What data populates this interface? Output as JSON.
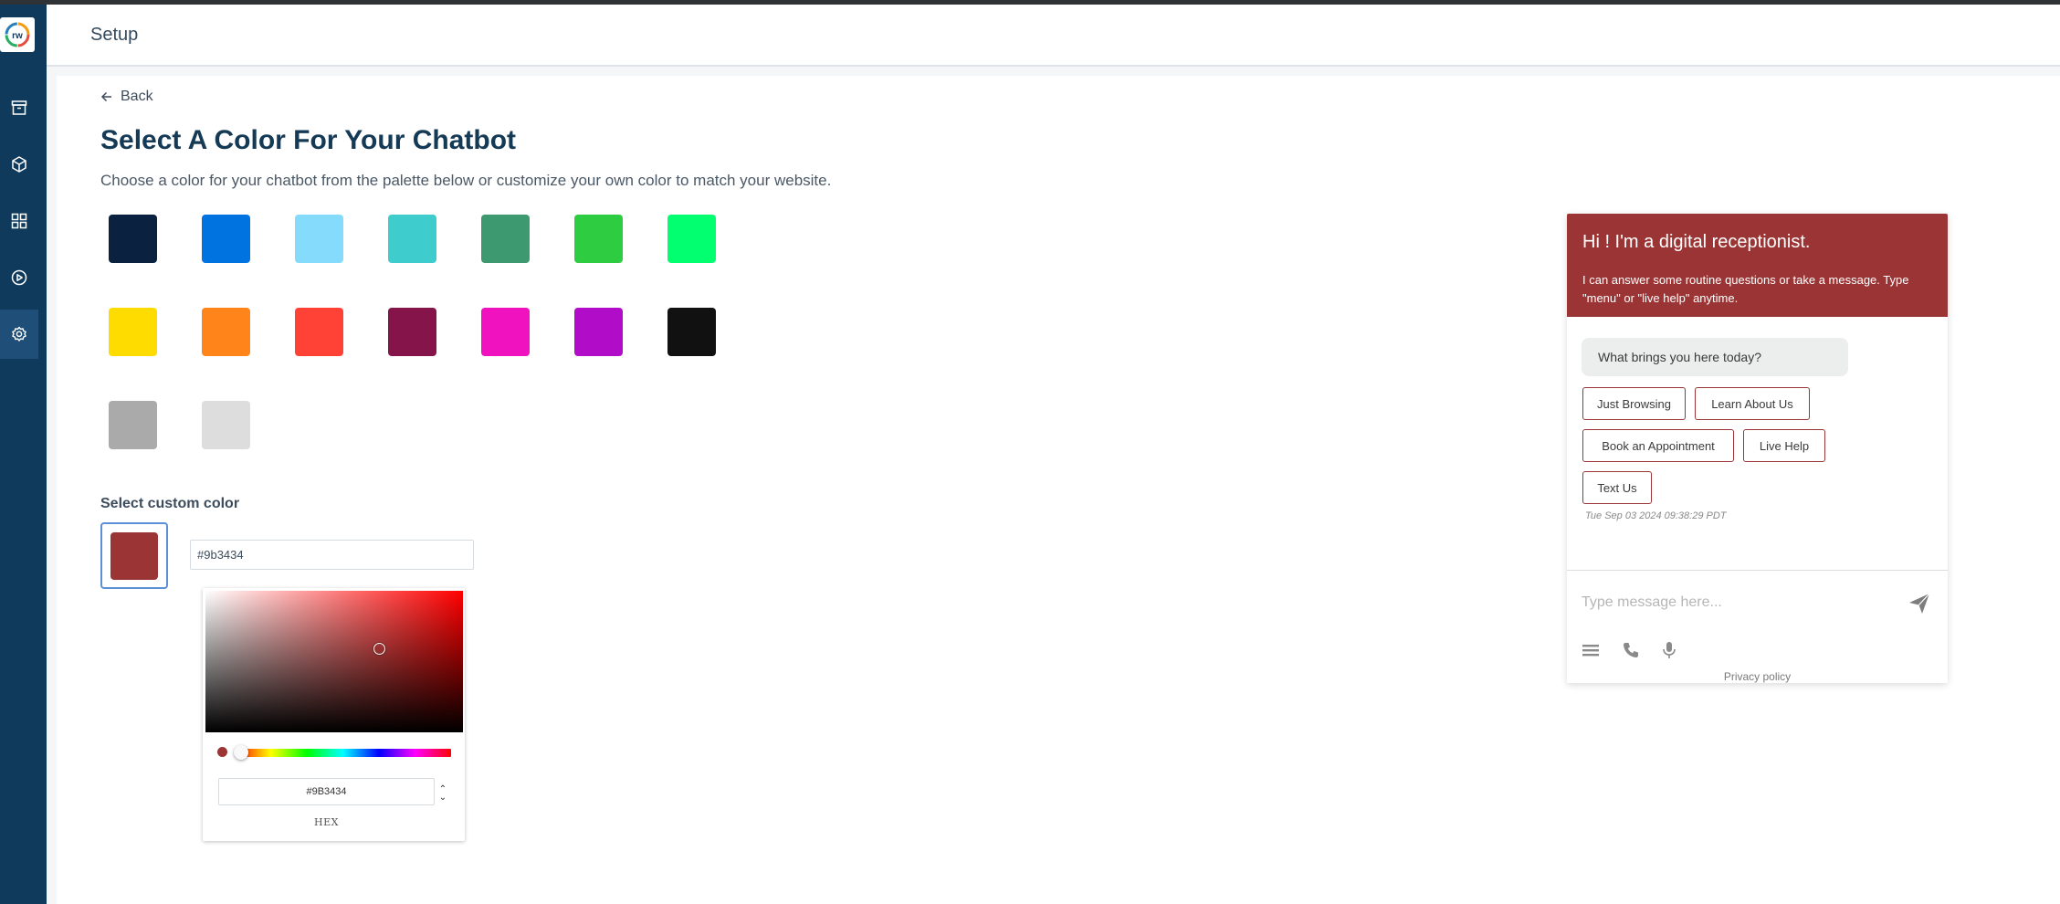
{
  "header": {
    "title": "Setup"
  },
  "sidebar": {
    "items": [
      {
        "name": "archive",
        "icon": "archive-icon"
      },
      {
        "name": "package",
        "icon": "cube-icon"
      },
      {
        "name": "dashboard",
        "icon": "grid-icon"
      },
      {
        "name": "media",
        "icon": "play-circle-icon"
      },
      {
        "name": "settings",
        "icon": "gear-icon",
        "active": true
      }
    ]
  },
  "page": {
    "back_label": "Back",
    "title": "Select A Color For Your Chatbot",
    "subtitle": "Choose a color for your chatbot from the palette below or customize your own color to match your website."
  },
  "palette": [
    [
      "#0b2140",
      "#0073e0",
      "#85dbfb",
      "#3ecccc",
      "#3d9970",
      "#2ecc40",
      "#01ff70"
    ],
    [
      "#ffdc00",
      "#ff851b",
      "#ff4136",
      "#85144b",
      "#f012be",
      "#b10dc9",
      "#111111"
    ],
    [
      "#aaaaaa",
      "#dddddd"
    ]
  ],
  "custom": {
    "label": "Select custom color",
    "value": "#9b3434",
    "picker_value": "#9B3434",
    "picker_mode": "HEX",
    "hue_color": "#ff0000",
    "toggle_up": "⌃",
    "toggle_down": "⌄"
  },
  "chat": {
    "accent": "#9b3434",
    "header_title": "Hi ! I'm a digital receptionist.",
    "header_sub": "I can answer some routine questions or take a message. Type \"menu\" or \"live help\" anytime.",
    "bubble": "What brings you here today?",
    "options": [
      "Just Browsing",
      "Learn About Us",
      "Book an Appointment",
      "Live Help",
      "Text Us"
    ],
    "timestamp": "Tue Sep 03 2024 09:38:29 PDT",
    "input_placeholder": "Type message here...",
    "privacy": "Privacy policy"
  }
}
